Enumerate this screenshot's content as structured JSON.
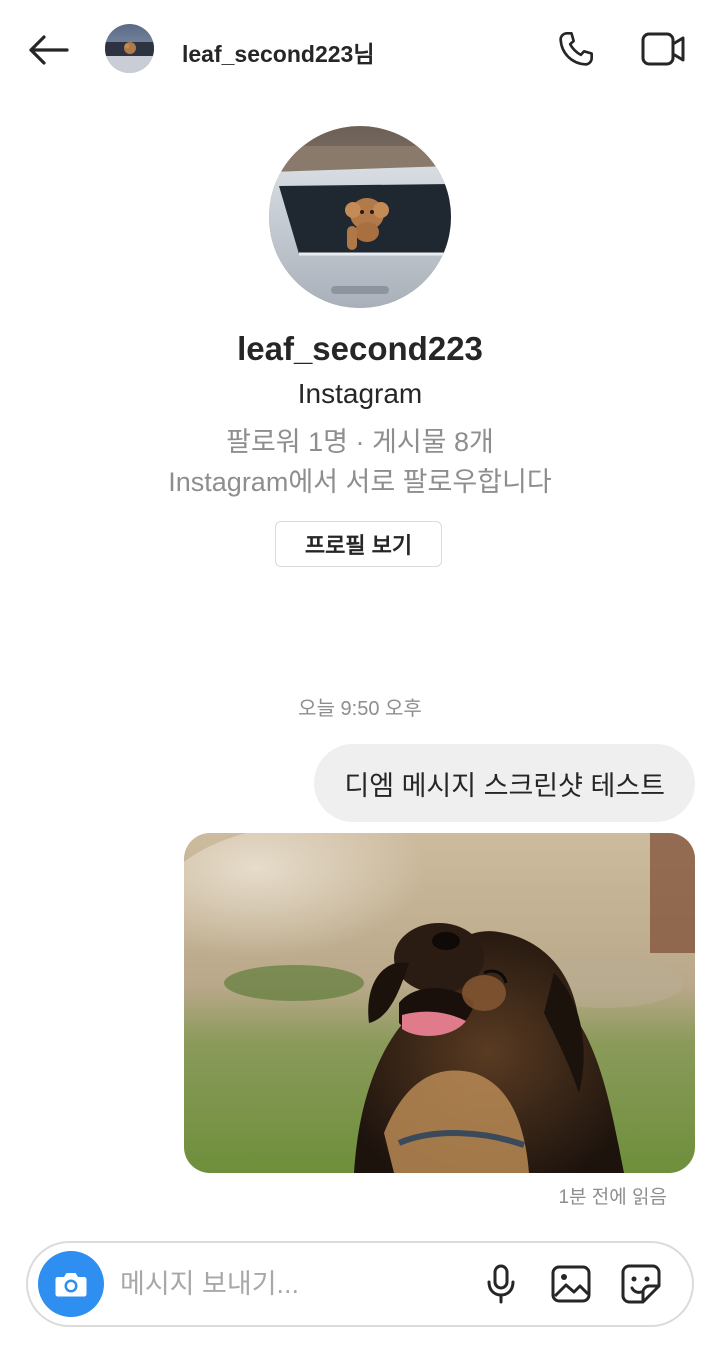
{
  "header": {
    "title": "leaf_second223님",
    "back_icon": "arrow-left-icon",
    "call_icon": "phone-icon",
    "video_icon": "video-camera-icon"
  },
  "profile": {
    "username": "leaf_second223",
    "subtitle": "Instagram",
    "stats": "팔로워 1명 · 게시물 8개",
    "mutual": "Instagram에서 서로 팔로우합니다",
    "view_profile_label": "프로필 보기"
  },
  "conversation": {
    "timestamp": "오늘 9:50 오후",
    "messages": [
      {
        "type": "text",
        "text": "디엠 메시지 스크린샷 테스트"
      },
      {
        "type": "photo",
        "subject": "dog-photo"
      }
    ],
    "read_receipt": "1분 전에 읽음"
  },
  "composer": {
    "placeholder": "메시지 보내기...",
    "value": "",
    "camera_icon": "camera-icon",
    "mic_icon": "microphone-icon",
    "gallery_icon": "gallery-icon",
    "sticker_icon": "sticker-icon"
  },
  "colors": {
    "text_primary": "#262626",
    "text_secondary": "#8e8e8e",
    "bubble_bg": "#efefef",
    "accent_blue": "#2e8ff0",
    "border": "#dbdbdb"
  }
}
